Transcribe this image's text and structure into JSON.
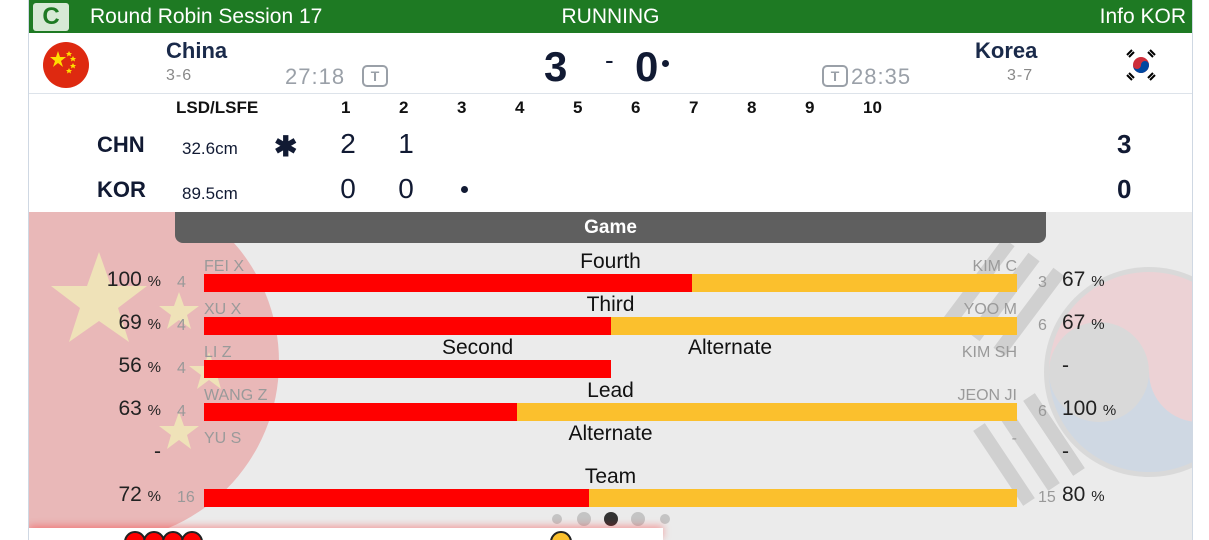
{
  "header": {
    "badge": "C",
    "session": "Round Robin Session 17",
    "status": "RUNNING",
    "info": "Info KOR",
    "colors": {
      "bar": "#1e7a23"
    }
  },
  "teams": {
    "home": {
      "name": "China",
      "record": "3-6",
      "clock": "27:18",
      "timeout_icon": "T",
      "score": "3",
      "flag": "china-flag"
    },
    "away": {
      "name": "Korea",
      "record": "3-7",
      "clock": "28:35",
      "timeout_icon": "T",
      "score": "0",
      "flag": "korea-flag"
    },
    "separator": "-"
  },
  "linescore": {
    "header_label": "LSD/LSFE",
    "ends": [
      "1",
      "2",
      "3",
      "4",
      "5",
      "6",
      "7",
      "8",
      "9",
      "10"
    ],
    "rows": [
      {
        "code": "CHN",
        "lsd": "32.6cm",
        "lsfe": "✱",
        "scores": [
          "2",
          "1"
        ],
        "total": "3"
      },
      {
        "code": "KOR",
        "lsd": "89.5cm",
        "scores": [
          "0",
          "0"
        ],
        "total": "0"
      }
    ]
  },
  "game": {
    "title": "Game",
    "positions": [
      {
        "label": "Fourth",
        "left_name": "FEI X",
        "right_name": "KIM C",
        "left_pct": "100",
        "right_pct": "67",
        "left_shots": "4",
        "right_shots": "3",
        "red_fraction": 0.6
      },
      {
        "label": "Third",
        "left_name": "XU X",
        "right_name": "YOO M",
        "left_pct": "69",
        "right_pct": "67",
        "left_shots": "4",
        "right_shots": "6",
        "red_fraction": 0.5
      },
      {
        "label": "Second",
        "label2": "Alternate",
        "left_name": "LI Z",
        "right_name": "KIM SH",
        "left_pct": "56",
        "right_pct": "-",
        "left_shots": "4",
        "right_shots": "",
        "red_fraction": 0.5
      },
      {
        "label": "Lead",
        "left_name": "WANG Z",
        "right_name": "JEON JI",
        "left_pct": "63",
        "right_pct": "100",
        "left_shots": "4",
        "right_shots": "6",
        "red_fraction": 0.385
      },
      {
        "label": "Alternate",
        "left_name": "YU S",
        "right_name": "-",
        "left_pct": "-",
        "right_pct": "-",
        "left_shots": "",
        "right_shots": ""
      },
      {
        "label": "Team",
        "left_name": "",
        "right_name": "",
        "left_pct": "72",
        "right_pct": "80",
        "left_shots": "16",
        "right_shots": "15",
        "red_fraction": 0.474
      }
    ],
    "pct_unit": "%",
    "colors": {
      "home": "#ff0000",
      "away": "#fbc02d"
    }
  },
  "pager": {
    "count": 5,
    "active": 2
  }
}
